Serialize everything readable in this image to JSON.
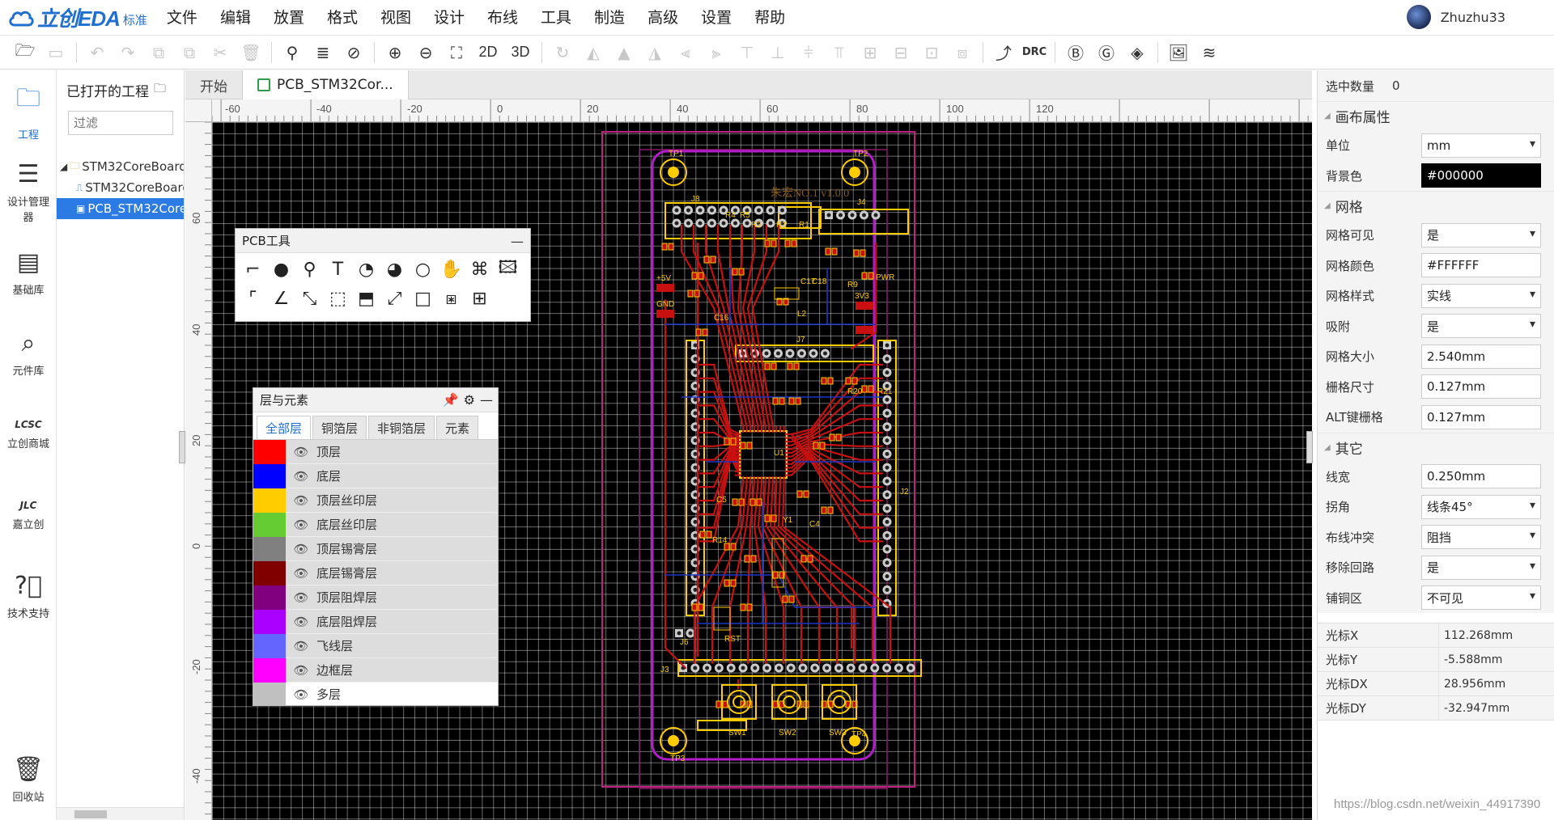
{
  "app": {
    "brand": "立创EDA",
    "edition": "标准",
    "user": "Zhuzhu33"
  },
  "menus": [
    "文件",
    "编辑",
    "放置",
    "格式",
    "视图",
    "设计",
    "布线",
    "工具",
    "制造",
    "高级",
    "设置",
    "帮助"
  ],
  "toolbar": {
    "btn_2d": "2D",
    "btn_3d": "3D",
    "btn_drc": "DRC"
  },
  "rail": [
    {
      "label": "工程",
      "icon": "folder-icon"
    },
    {
      "label": "设计管理器",
      "icon": "list-icon"
    },
    {
      "label": "基础库",
      "icon": "chip-icon"
    },
    {
      "label": "元件库",
      "icon": "search-icon"
    },
    {
      "label": "立创商城",
      "icon": "lcsc-icon"
    },
    {
      "label": "嘉立创",
      "icon": "jlc-icon"
    },
    {
      "label": "技术支持",
      "icon": "help-icon"
    },
    {
      "label": "回收站",
      "icon": "trash-icon"
    }
  ],
  "project_panel": {
    "title": "已打开的工程",
    "filter_placeholder": "过滤",
    "tree": [
      {
        "label": "STM32CoreBoard"
      },
      {
        "label": "STM32CoreBoard"
      },
      {
        "label": "PCB_STM32CoreBoard"
      }
    ]
  },
  "tabs": [
    "开始",
    "PCB_STM32Cor..."
  ],
  "ruler": {
    "h": [
      "-60",
      "-40",
      "-20",
      "0",
      "20",
      "40",
      "60",
      "80",
      "100",
      "120"
    ],
    "v": [
      "60",
      "40",
      "20",
      "0",
      "-20",
      "-40"
    ]
  },
  "pcb_tools": {
    "title": "PCB工具"
  },
  "layers_panel": {
    "title": "层与元素",
    "tabs": [
      "全部层",
      "铜箔层",
      "非铜箔层",
      "元素"
    ],
    "layers": [
      {
        "name": "顶层",
        "color": "#FF0000"
      },
      {
        "name": "底层",
        "color": "#0000FF"
      },
      {
        "name": "顶层丝印层",
        "color": "#FFCC00"
      },
      {
        "name": "底层丝印层",
        "color": "#66CC33"
      },
      {
        "name": "顶层锡膏层",
        "color": "#808080"
      },
      {
        "name": "底层锡膏层",
        "color": "#800000"
      },
      {
        "name": "顶层阻焊层",
        "color": "#800080"
      },
      {
        "name": "底层阻焊层",
        "color": "#AA00FF"
      },
      {
        "name": "飞线层",
        "color": "#6464FF"
      },
      {
        "name": "边框层",
        "color": "#FF00FF"
      },
      {
        "name": "多层",
        "color": "#C0C0C0"
      }
    ]
  },
  "pcb": {
    "silk_title": "朱宏NO.1 v1.0.0",
    "labels": [
      "TP1",
      "TP2",
      "TP3",
      "TP4",
      "J8",
      "J4",
      "J7",
      "J3",
      "J2",
      "J6",
      "U1",
      "Y1",
      "SW1",
      "SW2",
      "SW3",
      "RST",
      "+5V",
      "GND",
      "3V3",
      "PWR",
      "R1",
      "R2",
      "R3",
      "R4",
      "R5",
      "R9",
      "R20",
      "R21",
      "C17",
      "C18",
      "L2",
      "C16",
      "C5",
      "C4",
      "R14"
    ]
  },
  "props": {
    "sel_count_label": "选中数量",
    "sel_count": "0",
    "sections": {
      "canvas": "画布属性",
      "grid": "网格",
      "other": "其它"
    },
    "canvas_rows": [
      {
        "label": "单位",
        "value": "mm",
        "select": true
      },
      {
        "label": "背景色",
        "value": "#000000",
        "black": true
      }
    ],
    "grid_rows": [
      {
        "label": "网格可见",
        "value": "是",
        "select": true
      },
      {
        "label": "网格颜色",
        "value": "#FFFFFF"
      },
      {
        "label": "网格样式",
        "value": "实线",
        "select": true
      },
      {
        "label": "吸附",
        "value": "是",
        "select": true
      },
      {
        "label": "网格大小",
        "value": "2.540mm"
      },
      {
        "label": "栅格尺寸",
        "value": "0.127mm"
      },
      {
        "label": "ALT键栅格",
        "value": "0.127mm"
      }
    ],
    "other_rows": [
      {
        "label": "线宽",
        "value": "0.250mm"
      },
      {
        "label": "拐角",
        "value": "线条45°",
        "select": true
      },
      {
        "label": "布线冲突",
        "value": "阻挡",
        "select": true
      },
      {
        "label": "移除回路",
        "value": "是",
        "select": true
      },
      {
        "label": "铺铜区",
        "value": "不可见",
        "select": true
      }
    ],
    "cursor": [
      {
        "label": "光标X",
        "value": "112.268mm"
      },
      {
        "label": "光标Y",
        "value": "-5.588mm"
      },
      {
        "label": "光标DX",
        "value": "28.956mm"
      },
      {
        "label": "光标DY",
        "value": "-32.947mm"
      }
    ]
  },
  "watermark": "https://blog.csdn.net/weixin_44917390"
}
